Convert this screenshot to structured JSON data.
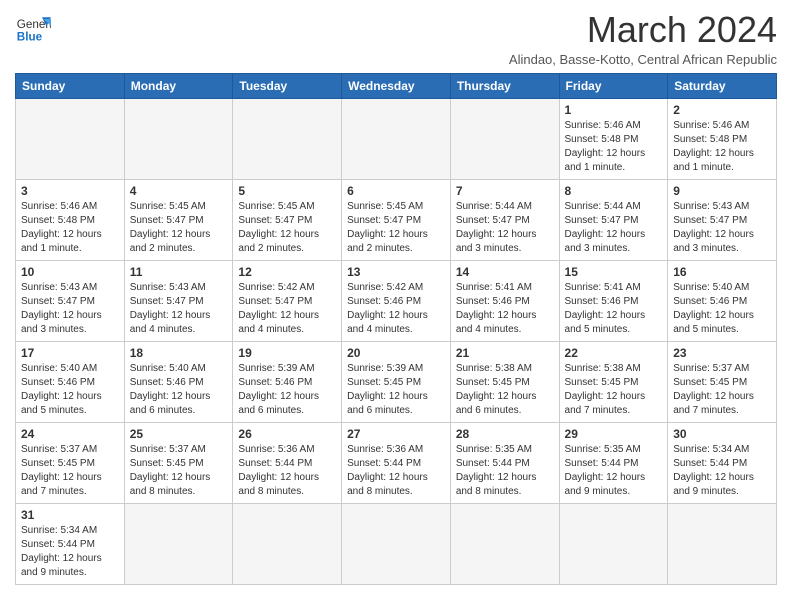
{
  "header": {
    "logo_general": "General",
    "logo_blue": "Blue",
    "month_title": "March 2024",
    "subtitle": "Alindao, Basse-Kotto, Central African Republic"
  },
  "weekdays": [
    "Sunday",
    "Monday",
    "Tuesday",
    "Wednesday",
    "Thursday",
    "Friday",
    "Saturday"
  ],
  "weeks": [
    [
      {
        "day": "",
        "info": ""
      },
      {
        "day": "",
        "info": ""
      },
      {
        "day": "",
        "info": ""
      },
      {
        "day": "",
        "info": ""
      },
      {
        "day": "",
        "info": ""
      },
      {
        "day": "1",
        "info": "Sunrise: 5:46 AM\nSunset: 5:48 PM\nDaylight: 12 hours and 1 minute."
      },
      {
        "day": "2",
        "info": "Sunrise: 5:46 AM\nSunset: 5:48 PM\nDaylight: 12 hours and 1 minute."
      }
    ],
    [
      {
        "day": "3",
        "info": "Sunrise: 5:46 AM\nSunset: 5:48 PM\nDaylight: 12 hours and 1 minute."
      },
      {
        "day": "4",
        "info": "Sunrise: 5:45 AM\nSunset: 5:47 PM\nDaylight: 12 hours and 2 minutes."
      },
      {
        "day": "5",
        "info": "Sunrise: 5:45 AM\nSunset: 5:47 PM\nDaylight: 12 hours and 2 minutes."
      },
      {
        "day": "6",
        "info": "Sunrise: 5:45 AM\nSunset: 5:47 PM\nDaylight: 12 hours and 2 minutes."
      },
      {
        "day": "7",
        "info": "Sunrise: 5:44 AM\nSunset: 5:47 PM\nDaylight: 12 hours and 3 minutes."
      },
      {
        "day": "8",
        "info": "Sunrise: 5:44 AM\nSunset: 5:47 PM\nDaylight: 12 hours and 3 minutes."
      },
      {
        "day": "9",
        "info": "Sunrise: 5:43 AM\nSunset: 5:47 PM\nDaylight: 12 hours and 3 minutes."
      }
    ],
    [
      {
        "day": "10",
        "info": "Sunrise: 5:43 AM\nSunset: 5:47 PM\nDaylight: 12 hours and 3 minutes."
      },
      {
        "day": "11",
        "info": "Sunrise: 5:43 AM\nSunset: 5:47 PM\nDaylight: 12 hours and 4 minutes."
      },
      {
        "day": "12",
        "info": "Sunrise: 5:42 AM\nSunset: 5:47 PM\nDaylight: 12 hours and 4 minutes."
      },
      {
        "day": "13",
        "info": "Sunrise: 5:42 AM\nSunset: 5:46 PM\nDaylight: 12 hours and 4 minutes."
      },
      {
        "day": "14",
        "info": "Sunrise: 5:41 AM\nSunset: 5:46 PM\nDaylight: 12 hours and 4 minutes."
      },
      {
        "day": "15",
        "info": "Sunrise: 5:41 AM\nSunset: 5:46 PM\nDaylight: 12 hours and 5 minutes."
      },
      {
        "day": "16",
        "info": "Sunrise: 5:40 AM\nSunset: 5:46 PM\nDaylight: 12 hours and 5 minutes."
      }
    ],
    [
      {
        "day": "17",
        "info": "Sunrise: 5:40 AM\nSunset: 5:46 PM\nDaylight: 12 hours and 5 minutes."
      },
      {
        "day": "18",
        "info": "Sunrise: 5:40 AM\nSunset: 5:46 PM\nDaylight: 12 hours and 6 minutes."
      },
      {
        "day": "19",
        "info": "Sunrise: 5:39 AM\nSunset: 5:46 PM\nDaylight: 12 hours and 6 minutes."
      },
      {
        "day": "20",
        "info": "Sunrise: 5:39 AM\nSunset: 5:45 PM\nDaylight: 12 hours and 6 minutes."
      },
      {
        "day": "21",
        "info": "Sunrise: 5:38 AM\nSunset: 5:45 PM\nDaylight: 12 hours and 6 minutes."
      },
      {
        "day": "22",
        "info": "Sunrise: 5:38 AM\nSunset: 5:45 PM\nDaylight: 12 hours and 7 minutes."
      },
      {
        "day": "23",
        "info": "Sunrise: 5:37 AM\nSunset: 5:45 PM\nDaylight: 12 hours and 7 minutes."
      }
    ],
    [
      {
        "day": "24",
        "info": "Sunrise: 5:37 AM\nSunset: 5:45 PM\nDaylight: 12 hours and 7 minutes."
      },
      {
        "day": "25",
        "info": "Sunrise: 5:37 AM\nSunset: 5:45 PM\nDaylight: 12 hours and 8 minutes."
      },
      {
        "day": "26",
        "info": "Sunrise: 5:36 AM\nSunset: 5:44 PM\nDaylight: 12 hours and 8 minutes."
      },
      {
        "day": "27",
        "info": "Sunrise: 5:36 AM\nSunset: 5:44 PM\nDaylight: 12 hours and 8 minutes."
      },
      {
        "day": "28",
        "info": "Sunrise: 5:35 AM\nSunset: 5:44 PM\nDaylight: 12 hours and 8 minutes."
      },
      {
        "day": "29",
        "info": "Sunrise: 5:35 AM\nSunset: 5:44 PM\nDaylight: 12 hours and 9 minutes."
      },
      {
        "day": "30",
        "info": "Sunrise: 5:34 AM\nSunset: 5:44 PM\nDaylight: 12 hours and 9 minutes."
      }
    ],
    [
      {
        "day": "31",
        "info": "Sunrise: 5:34 AM\nSunset: 5:44 PM\nDaylight: 12 hours and 9 minutes."
      },
      {
        "day": "",
        "info": ""
      },
      {
        "day": "",
        "info": ""
      },
      {
        "day": "",
        "info": ""
      },
      {
        "day": "",
        "info": ""
      },
      {
        "day": "",
        "info": ""
      },
      {
        "day": "",
        "info": ""
      }
    ]
  ]
}
